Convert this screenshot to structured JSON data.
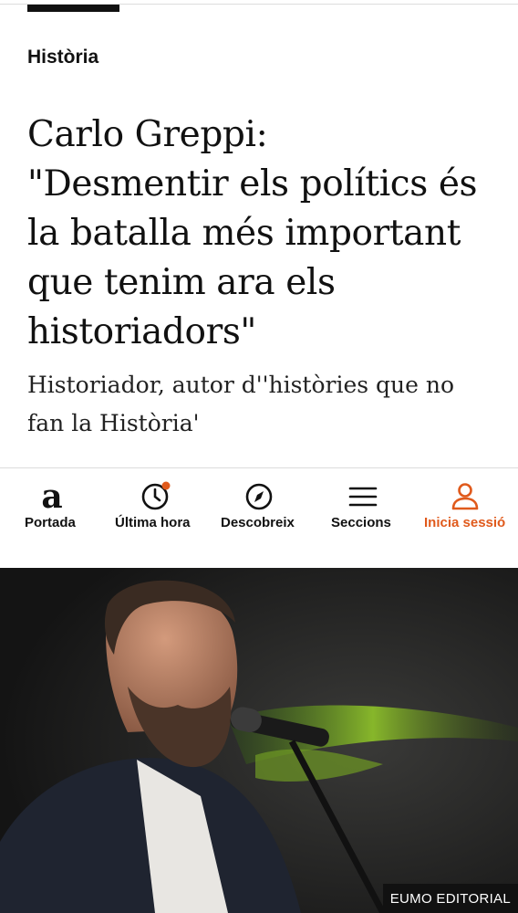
{
  "article": {
    "section": "Història",
    "headline_lines": [
      "Carlo Greppi:",
      "\"Desmentir els polítics és",
      "la batalla més important",
      "que tenim ara els",
      "historiadors\""
    ],
    "subtitle_lines": [
      "Historiador, autor d''històries que no",
      "fan la Història'"
    ]
  },
  "nav": {
    "items": [
      {
        "label": "Portada",
        "icon": "ara-logo-icon"
      },
      {
        "label": "Última hora",
        "icon": "clock-icon",
        "badge": true
      },
      {
        "label": "Descobreix",
        "icon": "compass-icon"
      },
      {
        "label": "Seccions",
        "icon": "menu-icon"
      },
      {
        "label": "Inicia sessió",
        "icon": "user-icon",
        "active": true
      }
    ],
    "logo_letter": "a",
    "accent_color": "#e05a1c"
  },
  "photo": {
    "credit": "EUMO EDITORIAL",
    "description_icon": "speaker-photo"
  }
}
